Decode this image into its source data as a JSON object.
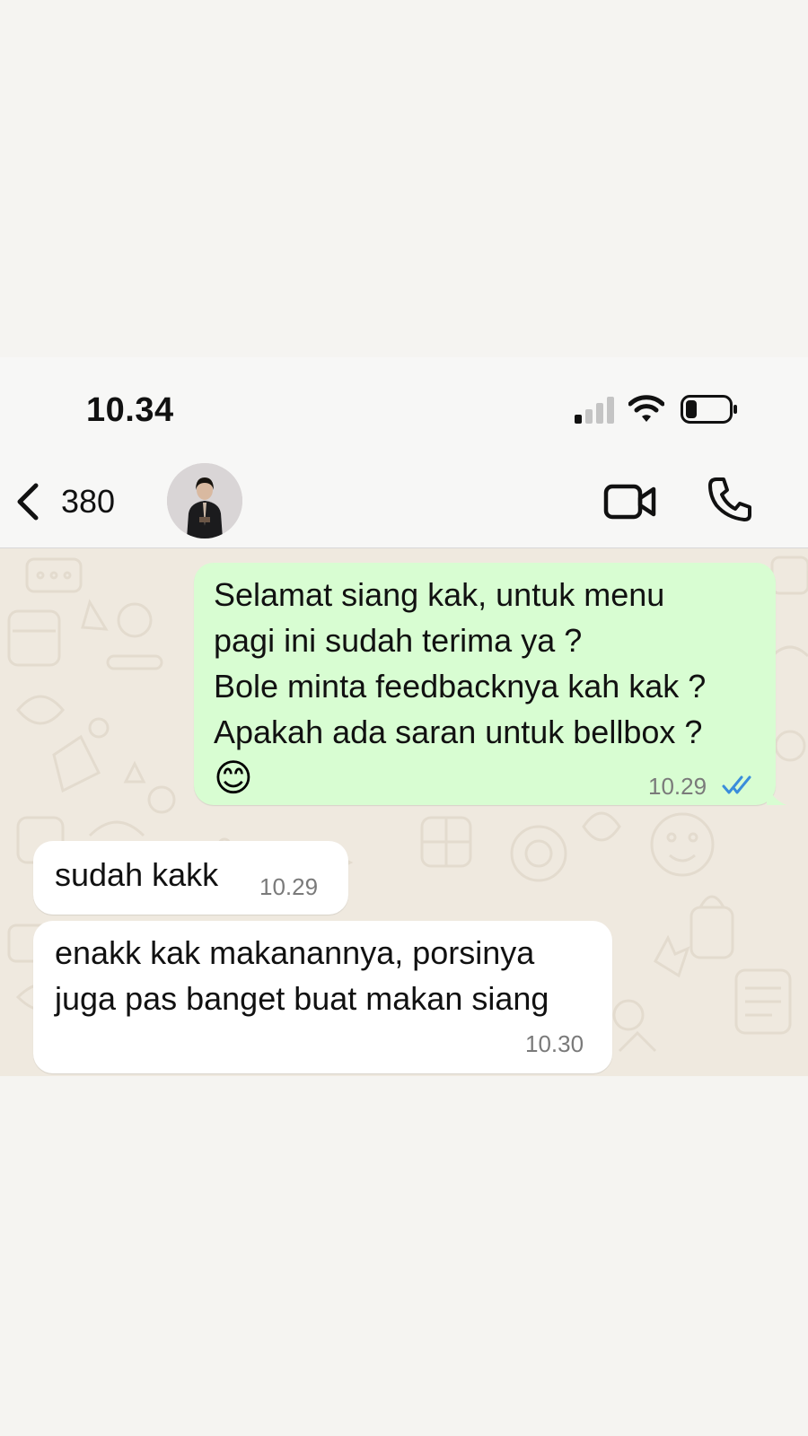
{
  "status_bar": {
    "time": "10.34",
    "signal_icon": "cellular-signal-icon",
    "wifi_icon": "wifi-icon",
    "battery_icon": "battery-icon",
    "battery_level": 0.25
  },
  "header": {
    "back_count": "380",
    "contact_name": "",
    "back_icon": "chevron-left-icon",
    "video_icon": "video-camera-icon",
    "call_icon": "phone-icon"
  },
  "colors": {
    "outgoing_bubble": "#d8fdd2",
    "incoming_bubble": "#ffffff",
    "chat_background": "#efe9df",
    "read_ticks": "#3a8ddb"
  },
  "messages": [
    {
      "direction": "outgoing",
      "lines": [
        "Selamat siang kak, untuk menu",
        "pagi ini sudah terima ya ?",
        "Bole minta feedbacknya kah kak ?",
        "Apakah ada saran untuk bellbox ?"
      ],
      "emoji": "😊",
      "time": "10.29",
      "status": "read"
    },
    {
      "direction": "incoming",
      "lines": [
        "sudah kakk"
      ],
      "time": "10.29"
    },
    {
      "direction": "incoming",
      "lines": [
        "enakk kak makanannya, porsinya",
        "juga pas banget buat makan siang"
      ],
      "time": "10.30"
    }
  ]
}
